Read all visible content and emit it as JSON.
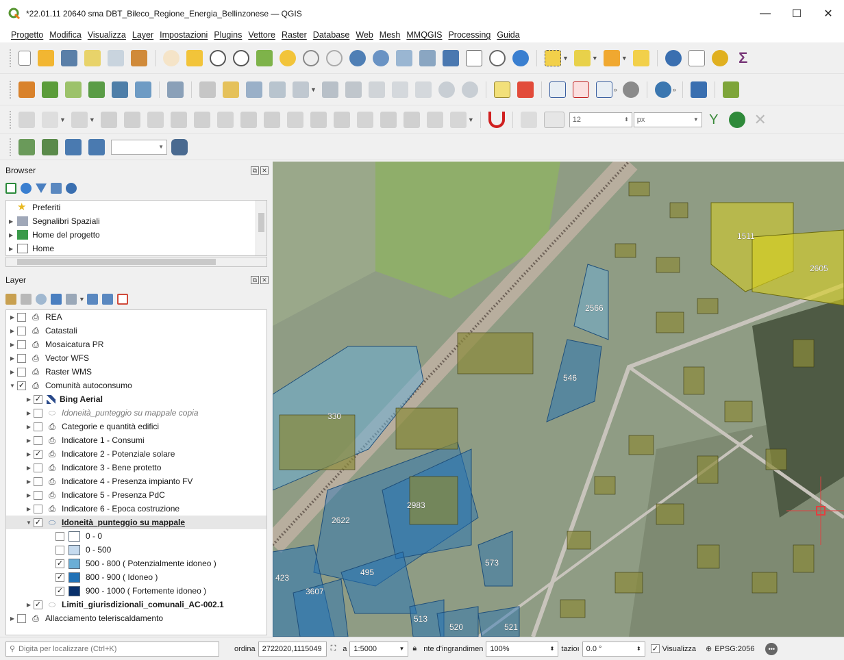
{
  "window": {
    "title": "*22.01.11 20640 sma DBT_Bileco_Regione_Energia_Bellinzonese — QGIS",
    "minimize": "—",
    "maximize": "☐",
    "close": "✕"
  },
  "menu": [
    "Progetto",
    "Modifica",
    "Visualizza",
    "Layer",
    "Impostazioni",
    "Plugins",
    "Vettore",
    "Raster",
    "Database",
    "Web",
    "Mesh",
    "MMQGIS",
    "Processing",
    "Guida"
  ],
  "toolbar3": {
    "size_value": "12",
    "unit_value": "px"
  },
  "browser": {
    "title": "Browser",
    "items": [
      {
        "label": "Preferiti",
        "icon": "star-icon"
      },
      {
        "label": "Segnalibri Spaziali",
        "icon": "bookmark-icon"
      },
      {
        "label": "Home del progetto",
        "icon": "project-home-icon"
      },
      {
        "label": "Home",
        "icon": "home-icon"
      }
    ]
  },
  "layers": {
    "title": "Layer",
    "groups": [
      {
        "label": "REA",
        "checked": false
      },
      {
        "label": "Catastali",
        "checked": false
      },
      {
        "label": "Mosaicatura PR",
        "checked": false
      },
      {
        "label": "Vector WFS",
        "checked": false
      },
      {
        "label": "Raster WMS",
        "checked": false
      },
      {
        "label": "Comunità autoconsumo",
        "checked": true
      }
    ],
    "children": [
      {
        "label": "Bing Aerial",
        "checked": true,
        "style": "bold"
      },
      {
        "label": "Idoneità_punteggio su mappale copia",
        "checked": false,
        "style": "italic"
      },
      {
        "label": "Categorie e quantità edifici",
        "checked": false,
        "style": "normal"
      },
      {
        "label": "Indicatore 1 - Consumi",
        "checked": false,
        "style": "normal"
      },
      {
        "label": "Indicatore 2 - Potenziale solare",
        "checked": true,
        "style": "normal"
      },
      {
        "label": "Indicatore 3 - Bene protetto",
        "checked": false,
        "style": "normal"
      },
      {
        "label": "Indicatore 4 - Presenza impianto FV",
        "checked": false,
        "style": "normal"
      },
      {
        "label": "Indicatore 5 - Presenza PdC",
        "checked": false,
        "style": "normal"
      },
      {
        "label": "Indicatore 6 - Epoca costruzione",
        "checked": false,
        "style": "normal"
      },
      {
        "label": "Idoneità_punteggio su mappale",
        "checked": true,
        "style": "selected"
      }
    ],
    "legend": [
      {
        "label": "0 - 0",
        "checked": false,
        "color": "#ffffff"
      },
      {
        "label": "0 - 500",
        "checked": false,
        "color": "#c6dbef"
      },
      {
        "label": "500 - 800 ( Potenzialmente idoneo )",
        "checked": true,
        "color": "#6baed6"
      },
      {
        "label": "800 - 900 ( Idoneo )",
        "checked": true,
        "color": "#2171b5"
      },
      {
        "label": "900 - 1000 ( Fortemente idoneo )",
        "checked": true,
        "color": "#08306b"
      }
    ],
    "after": [
      {
        "label": "Limiti_giurisdizionali_comunali_AC-002.1",
        "checked": true,
        "style": "bold"
      }
    ],
    "last": {
      "label": "Allacciamento teleriscaldamento",
      "checked": false
    }
  },
  "map": {
    "labels": [
      "1511",
      "2605",
      "2566",
      "546",
      "330",
      "2983",
      "2622",
      "573",
      "495",
      "423",
      "3607",
      "513",
      "520",
      "521"
    ]
  },
  "status": {
    "locator_placeholder": "Digita per localizzare (Ctrl+K)",
    "coord_label": "ordina",
    "coord_value": "2722020,1115049",
    "scale_label": "a",
    "scale_value": "1:5000",
    "magnifier_label": "nte d'ingrandimen",
    "magnifier_value": "100%",
    "rotation_label": "tazioı",
    "rotation_value": "0.0 °",
    "render_label": "Visualizza",
    "crs": "EPSG:2056"
  }
}
